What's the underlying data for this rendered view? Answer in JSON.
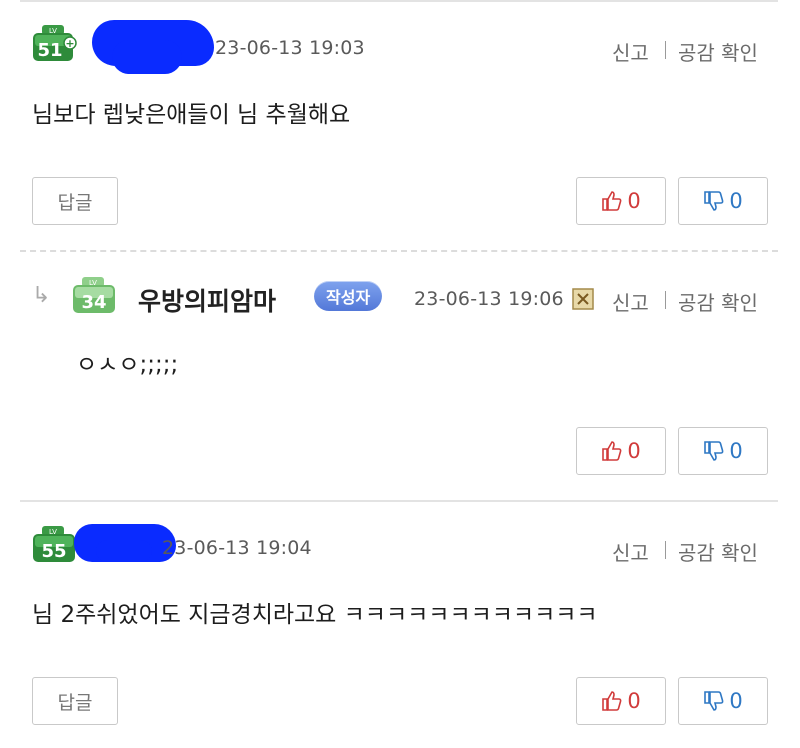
{
  "comments": [
    {
      "level": "51",
      "level_plus": true,
      "level_label": "LV",
      "date": "23-06-13 19:03",
      "text": "님보다 렙낮은애들이 님 추월해요",
      "report": "신고",
      "empathy": "공감 확인",
      "reply_label": "답글",
      "up": "0",
      "down": "0"
    },
    {
      "level": "34",
      "level_label": "LV",
      "nickname": "우방의피암마",
      "author_badge": "작성자",
      "date": "23-06-13 19:06",
      "text": "ㅇㅅㅇ;;;;;",
      "report": "신고",
      "empathy": "공감 확인",
      "up": "0",
      "down": "0"
    },
    {
      "level": "55",
      "level_label": "LV",
      "date": "23-06-13 19:04",
      "text": "님 2주쉬었어도 지금경치라고요 ㅋㅋㅋㅋㅋㅋㅋㅋㅋㅋㅋㅋ",
      "report": "신고",
      "empathy": "공감 확인",
      "reply_label": "답글",
      "up": "0",
      "down": "0"
    }
  ],
  "colors": {
    "level_badge_green": "#2e8b3a",
    "level_badge_light_green": "#7cc47a",
    "scribble_blue": "#0a2bff",
    "author_badge_blue": "#5b7fe0",
    "upvote_red": "#d13b3b",
    "downvote_blue": "#2f78c4"
  },
  "icons": [
    "reply-arrow-icon",
    "thumbs-up-icon",
    "thumbs-down-icon",
    "report-flag-icon"
  ]
}
